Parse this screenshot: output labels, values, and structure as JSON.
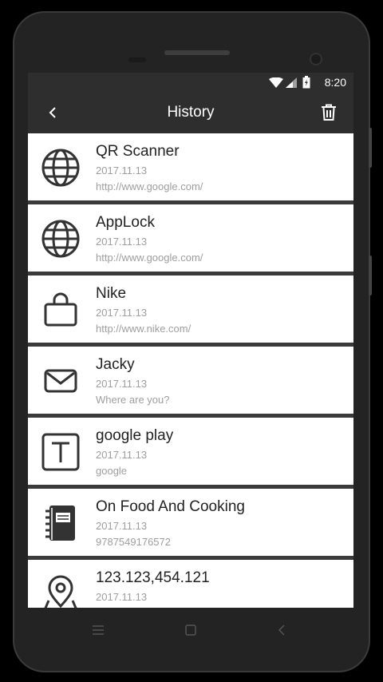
{
  "status": {
    "time": "8:20"
  },
  "appbar": {
    "title": "History"
  },
  "history": [
    {
      "icon": "globe-icon",
      "name": "QR Scanner",
      "date": "2017.11.13",
      "detail": "http://www.google.com/"
    },
    {
      "icon": "globe-icon",
      "name": "AppLock",
      "date": "2017.11.13",
      "detail": "http://www.google.com/"
    },
    {
      "icon": "shopping-bag-icon",
      "name": "Nike",
      "date": "2017.11.13",
      "detail": "http://www.nike.com/"
    },
    {
      "icon": "envelope-icon",
      "name": "Jacky",
      "date": "2017.11.13",
      "detail": "Where are you?"
    },
    {
      "icon": "text-icon",
      "name": "google play",
      "date": "2017.11.13",
      "detail": "google"
    },
    {
      "icon": "book-icon",
      "name": "On Food And Cooking",
      "date": "2017.11.13",
      "detail": "9787549176572"
    },
    {
      "icon": "map-pin-icon",
      "name": "123.123,454.121",
      "date": "2017.11.13",
      "detail": ""
    }
  ],
  "colors": {
    "bar": "#2e2e2e",
    "divider": "#3a3a3a",
    "item": "#ffffff",
    "icon": "#333333"
  }
}
